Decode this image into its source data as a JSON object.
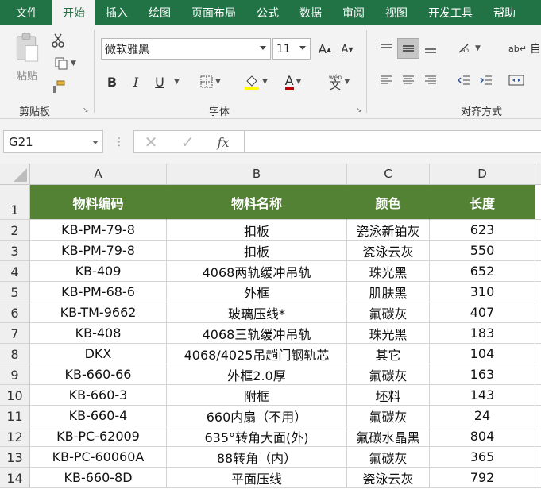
{
  "tabs": [
    {
      "label": "文件",
      "active": false
    },
    {
      "label": "开始",
      "active": true
    },
    {
      "label": "插入",
      "active": false
    },
    {
      "label": "绘图",
      "active": false
    },
    {
      "label": "页面布局",
      "active": false
    },
    {
      "label": "公式",
      "active": false
    },
    {
      "label": "数据",
      "active": false
    },
    {
      "label": "审阅",
      "active": false
    },
    {
      "label": "视图",
      "active": false
    },
    {
      "label": "开发工具",
      "active": false
    },
    {
      "label": "帮助",
      "active": false
    }
  ],
  "ribbon": {
    "clipboard": {
      "paste_label": "粘贴",
      "group_label": "剪贴板"
    },
    "font": {
      "font_name": "微软雅黑",
      "font_size": "11",
      "group_label": "字体",
      "bold": "B",
      "italic": "I",
      "underline": "U",
      "phonetic": "wén"
    },
    "alignment": {
      "group_label": "对齐方式",
      "wrap_partial": "自"
    }
  },
  "formula_bar": {
    "name_box": "G21",
    "formula": ""
  },
  "sheet": {
    "columns": [
      "A",
      "B",
      "C",
      "D"
    ],
    "header_fill": "#548235",
    "rows": [
      {
        "num": "1",
        "cells": [
          "物料编码",
          "物料名称",
          "颜色",
          "长度"
        ]
      },
      {
        "num": "2",
        "cells": [
          "KB-PM-79-8",
          "扣板",
          "瓷泳新铂灰",
          "623"
        ]
      },
      {
        "num": "3",
        "cells": [
          "KB-PM-79-8",
          "扣板",
          "瓷泳云灰",
          "550"
        ]
      },
      {
        "num": "4",
        "cells": [
          "KB-409",
          "4068两轨缓冲吊轨",
          "珠光黑",
          "652"
        ]
      },
      {
        "num": "5",
        "cells": [
          "KB-PM-68-6",
          "外框",
          "肌肤黑",
          "310"
        ]
      },
      {
        "num": "6",
        "cells": [
          "KB-TM-9662",
          "玻璃压线*",
          "氟碳灰",
          "407"
        ]
      },
      {
        "num": "7",
        "cells": [
          "KB-408",
          "4068三轨缓冲吊轨",
          "珠光黑",
          "183"
        ]
      },
      {
        "num": "8",
        "cells": [
          "DKX",
          "4068/4025吊趟门钢轨芯",
          "其它",
          "104"
        ]
      },
      {
        "num": "9",
        "cells": [
          "KB-660-66",
          "外框2.0厚",
          "氟碳灰",
          "163"
        ]
      },
      {
        "num": "10",
        "cells": [
          "KB-660-3",
          "附框",
          "坯料",
          "143"
        ]
      },
      {
        "num": "11",
        "cells": [
          "KB-660-4",
          "660内扇（不用）",
          "氟碳灰",
          "24"
        ]
      },
      {
        "num": "12",
        "cells": [
          "KB-PC-62009",
          "635°转角大面(外)",
          "氟碳水晶黑",
          "804"
        ]
      },
      {
        "num": "13",
        "cells": [
          "KB-PC-60060A",
          "88转角（内）",
          "氟碳灰",
          "365"
        ]
      },
      {
        "num": "14",
        "cells": [
          "KB-660-8D",
          "平面压线",
          "瓷泳云灰",
          "792"
        ]
      }
    ]
  }
}
